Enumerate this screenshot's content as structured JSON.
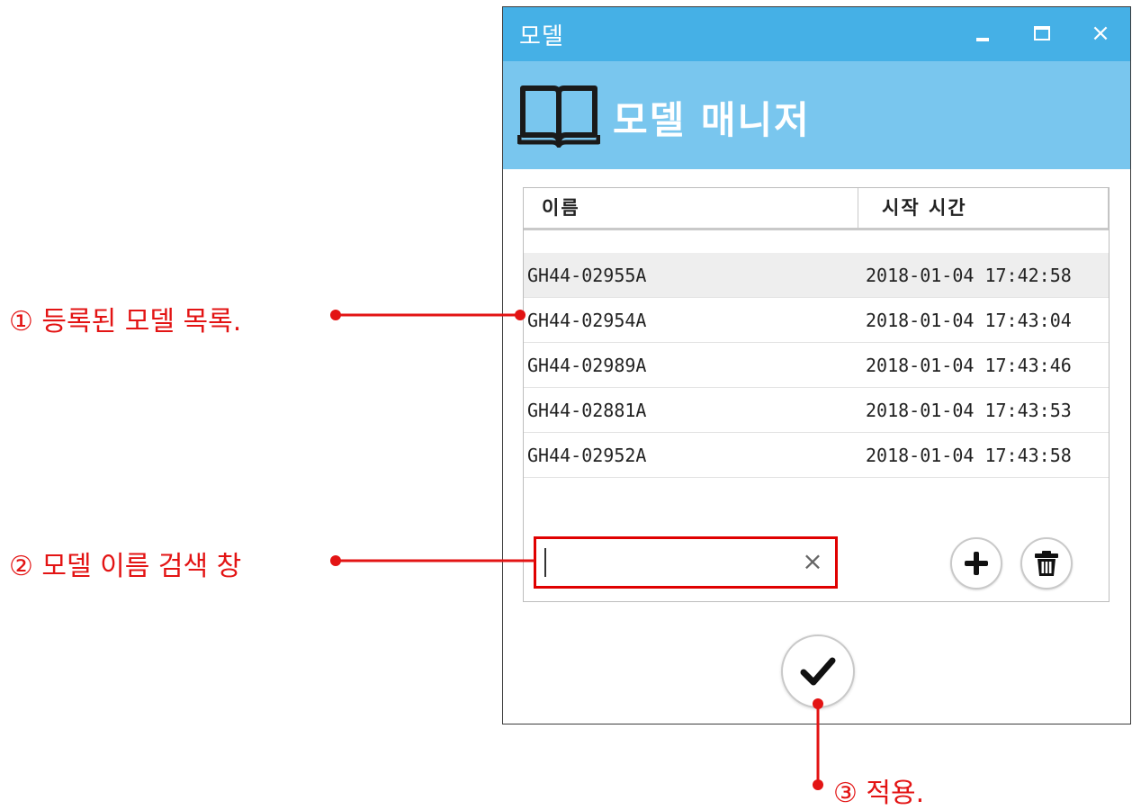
{
  "window": {
    "title": "모델",
    "close_glyph": "×",
    "header_title": "모델 매니저",
    "header_icon": "book-icon"
  },
  "list": {
    "columns": [
      "이름",
      "시작 시간"
    ],
    "rows": [
      {
        "name": "GH44-02955A",
        "time": "2018-01-04 17:42:58",
        "selected": true
      },
      {
        "name": "GH44-02954A",
        "time": "2018-01-04 17:43:04"
      },
      {
        "name": "GH44-02989A",
        "time": "2018-01-04 17:43:46"
      },
      {
        "name": "GH44-02881A",
        "time": "2018-01-04 17:43:53"
      },
      {
        "name": "GH44-02952A",
        "time": "2018-01-04 17:43:58"
      }
    ]
  },
  "search": {
    "value": "",
    "clear_glyph": "×"
  },
  "actions": {
    "add_icon": "plus-icon",
    "delete_icon": "trash-icon",
    "apply_icon": "check-icon"
  },
  "annotations": {
    "a1": "① 등록된 모델 목록.",
    "a2": "② 모델 이름 검색 창",
    "a3": "③ 적용."
  },
  "colors": {
    "titlebar": "#45b0e6",
    "header_band": "#79c6ee",
    "annotation": "#e31414",
    "search_highlight": "#e00000"
  }
}
